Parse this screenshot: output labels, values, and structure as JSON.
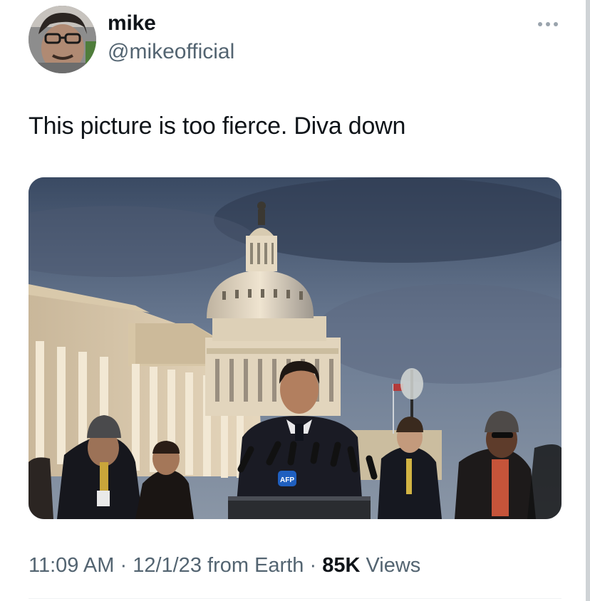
{
  "tweet": {
    "author": {
      "display_name": "mike",
      "handle": "@mikeofficial",
      "avatar_icon": "profile-photo"
    },
    "more_icon": "more-dots-icon",
    "text": "This picture is too fierce. Diva down",
    "media": {
      "kind": "photo",
      "visible_lettering": [
        "AFP"
      ]
    },
    "meta": {
      "time": "11:09 AM",
      "separator": "·",
      "date": "12/1/23",
      "source": "from Earth",
      "views_count": "85K",
      "views_label": "Views"
    }
  },
  "colors": {
    "text_primary": "#0f1419",
    "text_secondary": "#536471",
    "divider": "#eff3f4",
    "more_icon": "#9aa4ad"
  }
}
